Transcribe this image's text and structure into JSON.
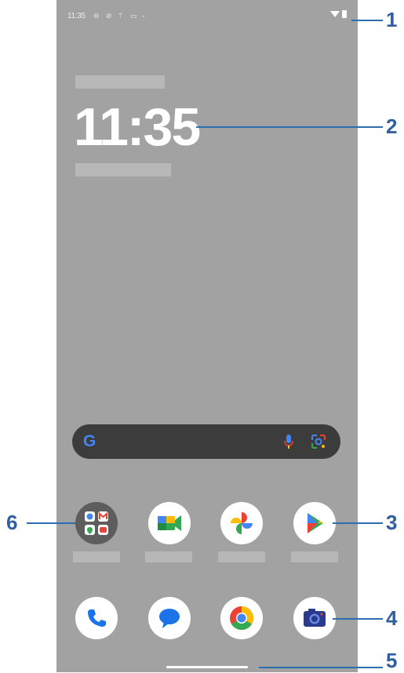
{
  "status_bar": {
    "time": "11:35"
  },
  "clock": {
    "time": "11:35"
  },
  "search_bar": {
    "logo": "G",
    "icons": [
      "google-g-icon",
      "mic-icon",
      "lens-icon"
    ]
  },
  "apps_row": [
    {
      "name": "folder",
      "icon": "google-apps-folder-icon"
    },
    {
      "name": "meet",
      "icon": "meet-icon"
    },
    {
      "name": "photos",
      "icon": "photos-icon"
    },
    {
      "name": "play-store",
      "icon": "play-store-icon"
    }
  ],
  "dock": [
    {
      "name": "phone",
      "icon": "phone-icon"
    },
    {
      "name": "messages",
      "icon": "messages-icon"
    },
    {
      "name": "chrome",
      "icon": "chrome-icon"
    },
    {
      "name": "camera",
      "icon": "camera-icon"
    }
  ],
  "callouts": [
    "1",
    "2",
    "3",
    "4",
    "5",
    "6"
  ],
  "colors": {
    "callout": "#2f6db3",
    "wallpaper": "#a2a2a2"
  }
}
